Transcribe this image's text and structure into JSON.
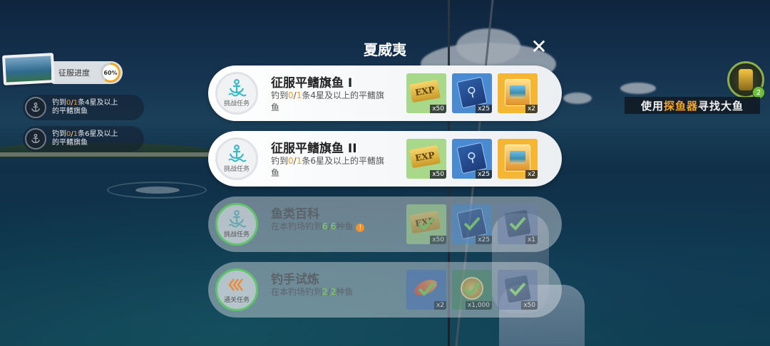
{
  "modal": {
    "title": "夏威夷",
    "close_icon": "close-icon"
  },
  "left_hud": {
    "progress_label": "征服进度",
    "progress_value": "60%",
    "progress_fraction": 0.6,
    "mini_quests": [
      {
        "prefix": "钓到",
        "current": "0",
        "sep": "/",
        "total": "1",
        "line1_suffix": "条4星及以上",
        "line2": "的平鳍旗鱼"
      },
      {
        "prefix": "钓到",
        "current": "0",
        "sep": "/",
        "total": "1",
        "line1_suffix": "条6星及以上",
        "line2": "的平鳍旗鱼"
      }
    ]
  },
  "right_hud": {
    "finder_badge": "2",
    "hint_pre": "使用",
    "hint_hl": "探鱼器",
    "hint_post": "寻找大鱼"
  },
  "quests": [
    {
      "title": "征服平鳍旗鱼 I",
      "tag": "挑战任务",
      "desc_prefix": "钓到",
      "desc_current": "0",
      "desc_sep": "/",
      "desc_total": "1",
      "desc_suffix": "条4星及以上的平鳍旗鱼",
      "rewards": [
        {
          "icon": "exp-ticket-icon",
          "label": "EXP",
          "qty": "x50"
        },
        {
          "icon": "blue-rod-pack-icon",
          "qty": "x25"
        },
        {
          "icon": "gold-photo-box-icon",
          "qty": "x2"
        }
      ]
    },
    {
      "title": "征服平鳍旗鱼 II",
      "tag": "挑战任务",
      "desc_prefix": "钓到",
      "desc_current": "0",
      "desc_sep": "/",
      "desc_total": "1",
      "desc_suffix": "条6星及以上的平鳍旗鱼",
      "rewards": [
        {
          "icon": "exp-ticket-icon",
          "label": "EXP",
          "qty": "x50"
        },
        {
          "icon": "blue-rod-pack-icon",
          "qty": "x25"
        },
        {
          "icon": "gold-photo-box-icon",
          "qty": "x2"
        }
      ]
    },
    {
      "title": "鱼类百科",
      "tag": "挑战任务",
      "desc_prefix": "在本钓场钓到",
      "desc_current": "6",
      "desc_sep": "/",
      "desc_total": "6",
      "desc_suffix": "种鱼",
      "warn": "!",
      "rewards": [
        {
          "icon": "exp-ticket-icon",
          "label": "EXP",
          "qty": "x50"
        },
        {
          "icon": "blue-rod-pack-icon",
          "qty": "x25"
        },
        {
          "icon": "dark-pack-icon",
          "qty": "x1"
        }
      ]
    },
    {
      "title": "钓手试炼",
      "tag": "通关任务",
      "desc_prefix": "在本钓场钓到",
      "desc_current": "2",
      "desc_sep": "/",
      "desc_total": "2",
      "desc_suffix": "种鱼",
      "rewards": [
        {
          "icon": "red-lure-icon",
          "qty": "x2"
        },
        {
          "icon": "coin-icon",
          "qty": "x1,000"
        },
        {
          "icon": "dark-pack-icon",
          "qty": "x50"
        }
      ]
    }
  ],
  "colors": {
    "accent_orange": "#f59a2b",
    "complete_green": "#7dd35a",
    "anchor_teal": "#35b8c8"
  }
}
